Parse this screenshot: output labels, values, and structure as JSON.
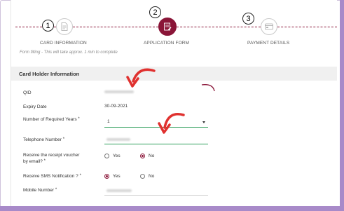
{
  "stepper": {
    "steps": [
      {
        "number": "1",
        "label": "CARD INFORMATION",
        "icon": "document-icon",
        "active": false
      },
      {
        "number": "2",
        "label": "APPLICATION FORM",
        "icon": "form-icon",
        "active": true
      },
      {
        "number": "3",
        "label": "PAYMENT DETAILS",
        "icon": "card-icon",
        "active": false
      }
    ],
    "note": "Form filling - This will take approx. 1 min to complete",
    "accent_color": "#8a1538"
  },
  "section": {
    "title": "Card Holder Information"
  },
  "form": {
    "qid": {
      "label": "QID"
    },
    "expiry": {
      "label": "Expiry Date",
      "value": "30-09-2021"
    },
    "years": {
      "label": "Number of Required Years",
      "required": "*",
      "value": "1"
    },
    "telephone": {
      "label": "Telephone Number",
      "required": "*"
    },
    "receipt": {
      "label_line1": "Receive the receipt voucher",
      "label_line2": "by email?",
      "required": "*",
      "options": [
        "Yes",
        "No"
      ],
      "selected": "No"
    },
    "sms": {
      "label": "Receive SMS Notification ?",
      "required": "*",
      "options": [
        "Yes",
        "No"
      ],
      "selected": "Yes"
    },
    "mobile": {
      "label": "Mobile Number",
      "required": "*"
    }
  },
  "annotation_color": "#e0312f"
}
